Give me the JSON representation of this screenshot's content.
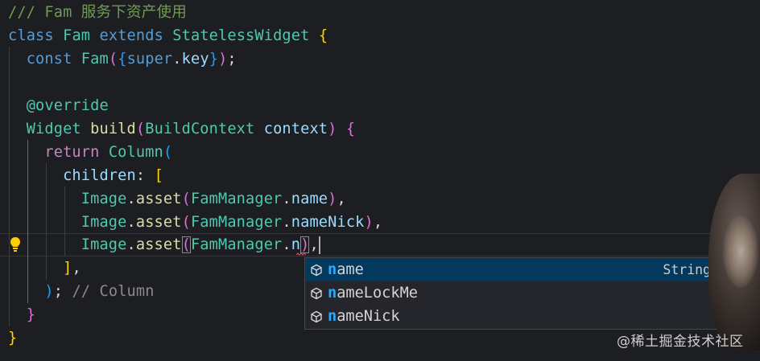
{
  "editor": {
    "lines": {
      "l1": {
        "comment": "/// Fam 服务下资产使用"
      },
      "l2": {
        "kw": "class",
        "name": "Fam",
        "extends": "extends",
        "base": "StatelessWidget",
        "brace": "{"
      },
      "l3": {
        "kw": "const",
        "name": "Fam",
        "p1": "(",
        "b1": "{",
        "sup": "super",
        "dot": ".",
        "key": "key",
        "b2": "}",
        "p2": ")",
        "semi": ";"
      },
      "l5": {
        "ann": "@override"
      },
      "l6": {
        "type": "Widget",
        "fn": "build",
        "p1": "(",
        "ptype": "BuildContext",
        "pname": "context",
        "p2": ")",
        "brace": "{"
      },
      "l7": {
        "kw": "return",
        "type": "Column",
        "p": "("
      },
      "l8": {
        "prop": "children",
        "colon": ":",
        "b": "["
      },
      "l9": {
        "type": "Image",
        "dot": ".",
        "fn": "asset",
        "p1": "(",
        "cls": "FamManager",
        "dot2": ".",
        "member": "name",
        "p2": ")",
        "comma": ","
      },
      "l10": {
        "type": "Image",
        "dot": ".",
        "fn": "asset",
        "p1": "(",
        "cls": "FamManager",
        "dot2": ".",
        "member": "nameNick",
        "p2": ")",
        "comma": ","
      },
      "l11": {
        "type": "Image",
        "dot": ".",
        "fn": "asset",
        "p1": "(",
        "cls": "FamManager",
        "dot2": ".",
        "member": "n",
        "p2": ")",
        "comma": ","
      },
      "l12": {
        "b": "]",
        "comma": ","
      },
      "l13": {
        "p": ")",
        "semi": ";",
        "comment": "// Column"
      },
      "l14": {
        "brace": "}"
      },
      "l15": {
        "brace": "}"
      }
    }
  },
  "suggest": {
    "items": [
      {
        "match": "n",
        "rest": "ame",
        "type": "String"
      },
      {
        "match": "n",
        "rest": "ameLockMe",
        "type": ""
      },
      {
        "match": "n",
        "rest": "ameNick",
        "type": ""
      }
    ]
  },
  "watermark": "@稀土掘金技术社区",
  "colors": {
    "background": "#1d1e22",
    "selection": "#04395e",
    "match_highlight": "#2aaaff"
  },
  "icons": [
    "lightbulb-icon",
    "property-icon"
  ]
}
